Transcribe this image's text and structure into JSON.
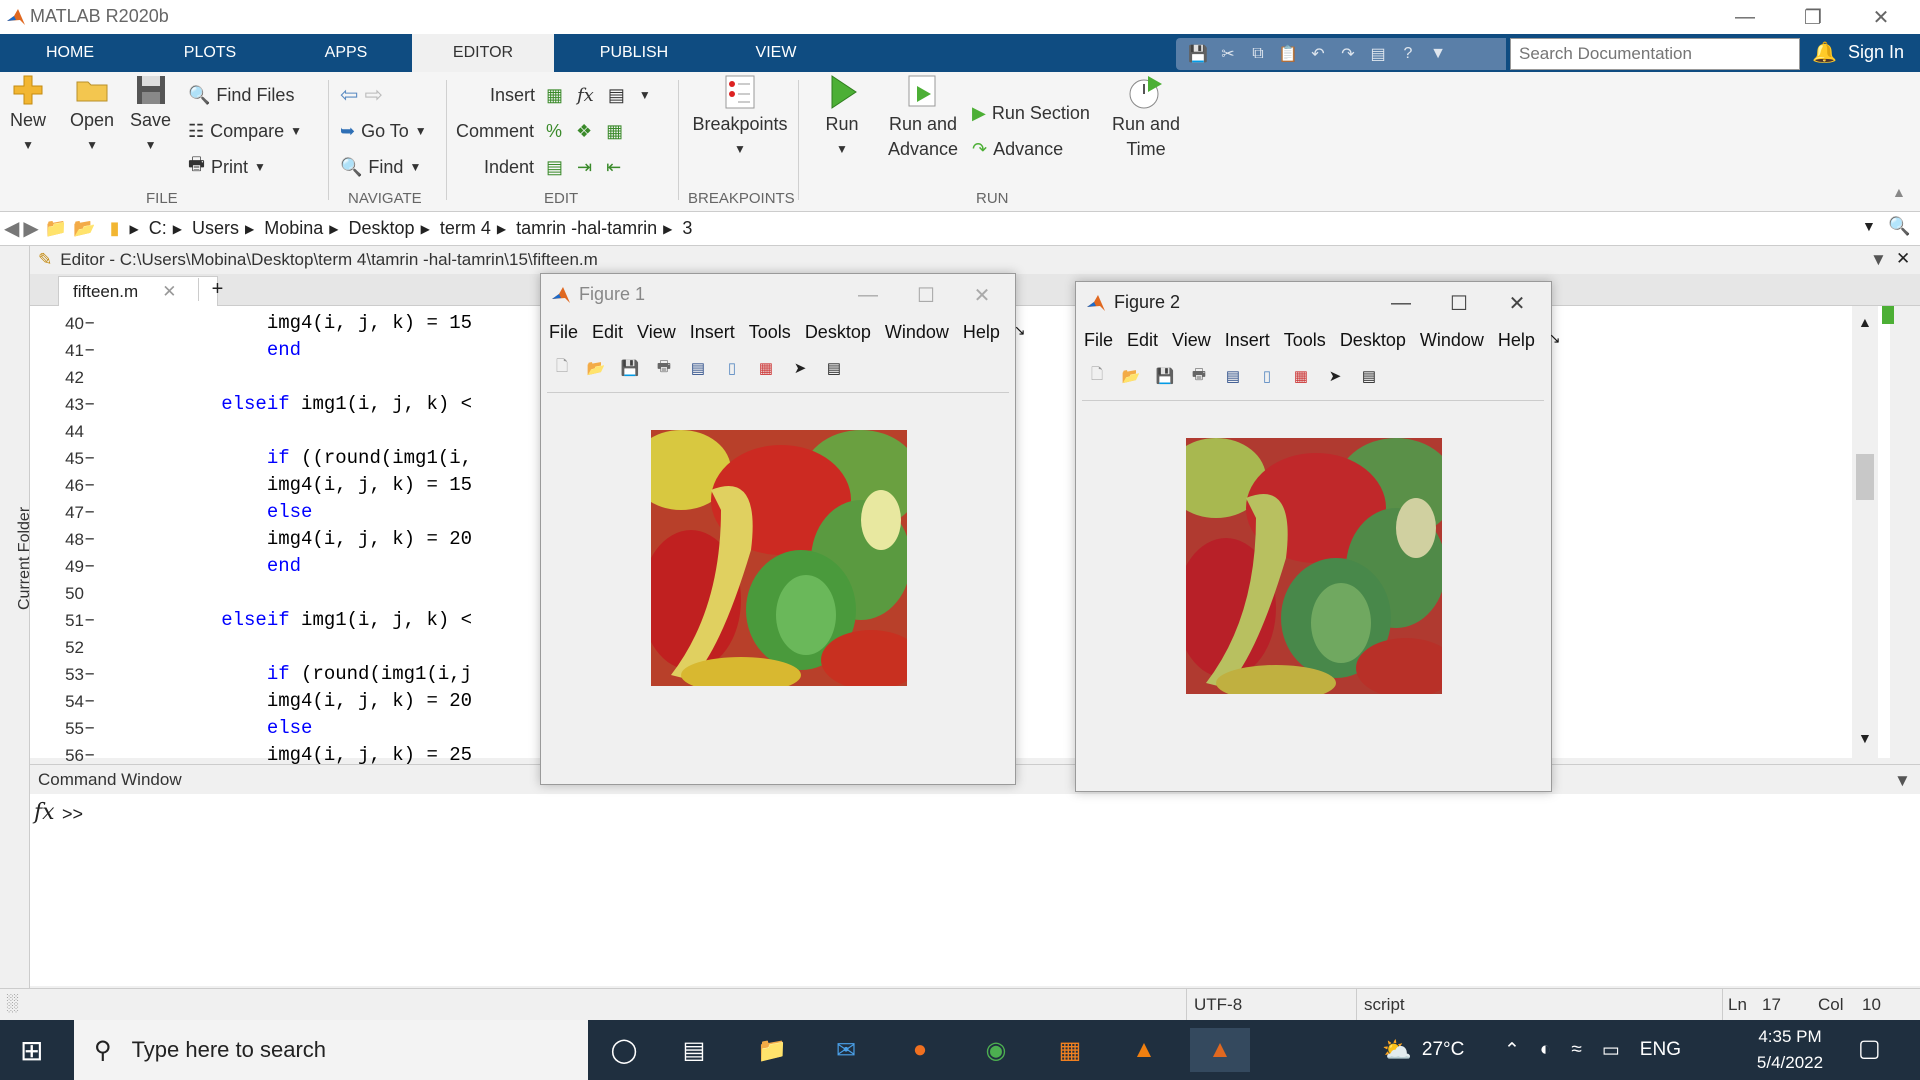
{
  "app": {
    "title": "MATLAB R2020b"
  },
  "tabs": [
    {
      "label": "HOME"
    },
    {
      "label": "PLOTS"
    },
    {
      "label": "APPS"
    },
    {
      "label": "EDITOR"
    },
    {
      "label": "PUBLISH"
    },
    {
      "label": "VIEW"
    }
  ],
  "search": {
    "placeholder": "Search Documentation"
  },
  "signin": "Sign In",
  "ribbon": {
    "file": {
      "new": "New",
      "open": "Open",
      "save": "Save",
      "find_files": "Find Files",
      "compare": "Compare",
      "print": "Print",
      "group": "FILE"
    },
    "navigate": {
      "goto": "Go To",
      "find": "Find",
      "group": "NAVIGATE"
    },
    "edit": {
      "insert": "Insert",
      "comment": "Comment",
      "indent": "Indent",
      "group": "EDIT"
    },
    "breakpoints": {
      "label": "Breakpoints",
      "group": "BREAKPOINTS"
    },
    "run": {
      "run": "Run",
      "run_advance_1": "Run and",
      "run_advance_2": "Advance",
      "run_section": "Run Section",
      "advance": "Advance",
      "run_time_1": "Run and",
      "run_time_2": "Time",
      "group": "RUN"
    }
  },
  "address": {
    "crumbs": [
      "C:",
      "Users",
      "Mobina",
      "Desktop",
      "term 4",
      "tamrin -hal-tamrin",
      "3"
    ]
  },
  "current_folder_label": "Current Folder",
  "editor": {
    "title": "Editor - C:\\Users\\Mobina\\Desktop\\term 4\\tamrin -hal-tamrin\\15\\fifteen.m",
    "tab": "fifteen.m",
    "lines": [
      {
        "n": "40",
        "d": "–",
        "code": "            img4(i, j, k) = 15"
      },
      {
        "n": "41",
        "d": "–",
        "code": "            end"
      },
      {
        "n": "42",
        "d": "",
        "code": ""
      },
      {
        "n": "43",
        "d": "–",
        "code": "        elseif img1(i, j, k) <"
      },
      {
        "n": "44",
        "d": "",
        "code": ""
      },
      {
        "n": "45",
        "d": "–",
        "code": "            if ((round(img1(i,"
      },
      {
        "n": "46",
        "d": "–",
        "code": "            img4(i, j, k) = 15"
      },
      {
        "n": "47",
        "d": "–",
        "code": "            else"
      },
      {
        "n": "48",
        "d": "–",
        "code": "            img4(i, j, k) = 20"
      },
      {
        "n": "49",
        "d": "–",
        "code": "            end"
      },
      {
        "n": "50",
        "d": "",
        "code": ""
      },
      {
        "n": "51",
        "d": "–",
        "code": "        elseif img1(i, j, k) <"
      },
      {
        "n": "52",
        "d": "",
        "code": ""
      },
      {
        "n": "53",
        "d": "–",
        "code": "            if (round(img1(i,j"
      },
      {
        "n": "54",
        "d": "–",
        "code": "            img4(i, j, k) = 20"
      },
      {
        "n": "55",
        "d": "–",
        "code": "            else"
      },
      {
        "n": "56",
        "d": "–",
        "code": "            img4(i, j, k) = 25"
      }
    ]
  },
  "command_window": {
    "title": "Command Window",
    "prompt": ">>",
    "fx": "fx"
  },
  "figures": [
    {
      "title": "Figure 1",
      "menu": [
        "File",
        "Edit",
        "View",
        "Insert",
        "Tools",
        "Desktop",
        "Window",
        "Help"
      ]
    },
    {
      "title": "Figure 2",
      "menu": [
        "File",
        "Edit",
        "View",
        "Insert",
        "Tools",
        "Desktop",
        "Window",
        "Help"
      ]
    }
  ],
  "status": {
    "encoding": "UTF-8",
    "type": "script",
    "ln_label": "Ln",
    "ln": "17",
    "col_label": "Col",
    "col": "10"
  },
  "taskbar": {
    "search": "Type here to search",
    "temp": "27°C",
    "lang": "ENG",
    "time": "4:35 PM",
    "date": "5/4/2022"
  },
  "colors": {
    "ribbon_tab": "#0f4c81",
    "keyword": "#0000ff",
    "taskbar": "#1f2f3f"
  }
}
